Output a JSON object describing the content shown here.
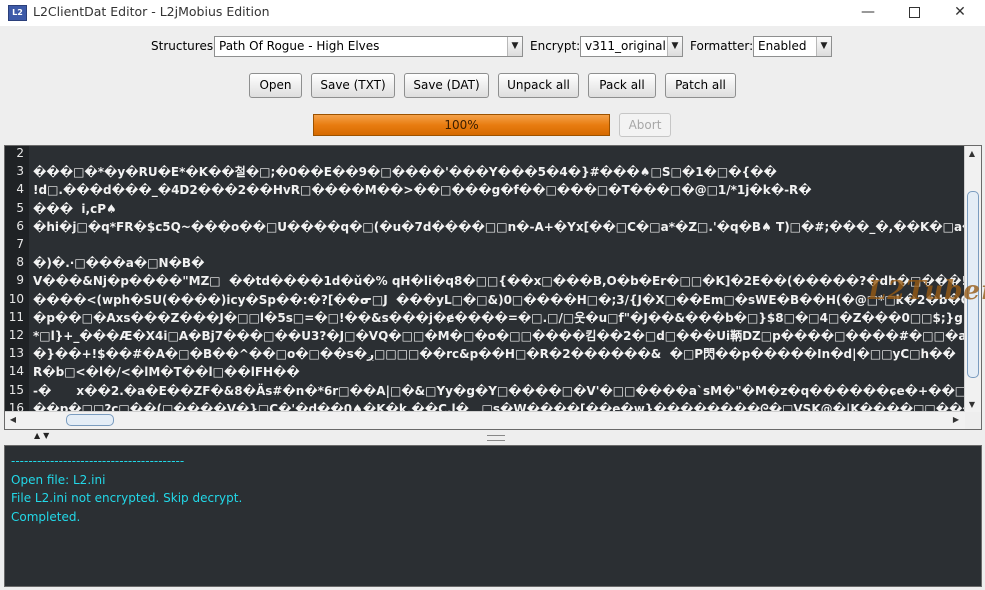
{
  "window": {
    "icon_text": "L2",
    "title": "L2ClientDat Editor - L2jMobius Edition",
    "minimize": "—",
    "close": "✕"
  },
  "toolbar": {
    "structures_label": "Structures",
    "structures_value": "Path Of Rogue - High Elves",
    "encrypt_label": "Encrypt:",
    "encrypt_value": "v311_original",
    "formatter_label": "Formatter:",
    "formatter_value": "Enabled",
    "buttons": {
      "open": "Open",
      "save_txt": "Save (TXT)",
      "save_dat": "Save (DAT)",
      "unpack_all": "Unpack all",
      "pack_all": "Pack all",
      "patch_all": "Patch all"
    }
  },
  "progress": {
    "value": 100,
    "label": "100%",
    "abort_label": "Abort"
  },
  "editor": {
    "line_numbers": [
      "2",
      "3",
      "4",
      "5",
      "6",
      "7",
      "8",
      "9",
      "10",
      "11",
      "12",
      "13",
      "14",
      "15",
      "16"
    ],
    "lines": [
      "",
      "���□�*�y�RU�E*�K��철�□;�0��E��9�□����'���Y���5�4�}#���♠□S□�1�□�{��",
      "!d□.���d���_�4D2���2��HvR□����M��>��□���g�f��□���□�T���□�@□1/*1j�k�-R�",
      "���  i,cP♠",
      "�hi�j□�q*FR�$c5Q~���o��□U����q�□(�u�7d����□□n�-A+�Yx[��□C�□a*�Z□.'�q�B♠ T)□�#;���_�,��K�□a�H���□□",
      "",
      "�)�.·□���a�□N�B�",
      "V���&Nj�p����\"MZ□  ��td����1d�ǔ�% qH�li�q8�□□{��x□���B,O�b�Er�□□�K]�2E��(�����?�dh�□���!0!�3��^□",
      "����<(wph�SU(����)icy�Sp��:�?[��ᓂ□J  ���yL□�□&)0□����H□�;3/{J�X□��Em□�sWE�B��H(�@□*□k�2�b�G*A�□□",
      "�p��□�Axs���Z���J�□□l�5s□=�□!��&s���j�ɇ����=�□.□/□웃�u□f\"�J��&���b�□}$8□�□4□�Z���0□□$;}g♠�□����",
      "*□l}+_���Æ�X4i□A�Bj7���□��U3?�J□�VQ�□□�M�□�o�□□����킴��2�□d□���Ui鞆DZ□p����□����#�□□�aw□□",
      "�}��+!$��#�A�□�B��^��□o�□��s�ږ□□□□��rc&p��H□�R�2������&  �□P閃��p�����In�d|�□□yC□h��           ��",
      "R�b□<�l�/<�lM�T��l□��lFH��",
      "-�      x��2.�a�E��ZF�&8�Äs#�n�*6r□��A|□�&□Yy�g�Y□����□�V'�□□����a`sM�\"�M�z�q������ɕe�+��□{□�G6□",
      "��p�□□?c□��(□����V�}□C�'�d��0♠�K�k,��C.l�   □s�W����[��e�w}��������ᘓ�□VSK@�|K����□□���KK��"
    ]
  },
  "log": {
    "lines": [
      "----------------------------------------",
      "Open file: L2.ini",
      "File L2.ini not encrypted. Skip decrypt.",
      "Completed."
    ]
  },
  "watermark": "L2Tuber"
}
